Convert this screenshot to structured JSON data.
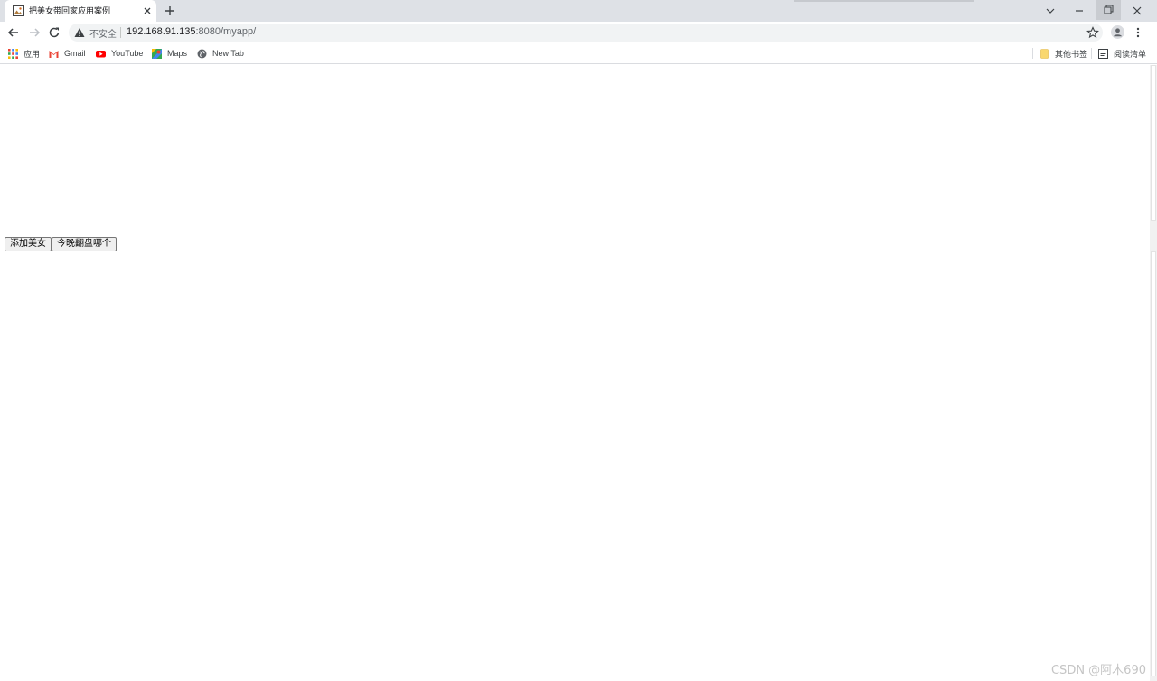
{
  "browser": {
    "tab": {
      "title": "把美女带回家应用案例",
      "favicon": "picture-icon"
    },
    "window_controls": [
      "chevron-down-icon",
      "minimize-icon",
      "restore-icon",
      "close-icon"
    ],
    "address_bar": {
      "security_label": "不安全",
      "url_host": "192.168.91.135",
      "url_path": ":8080/myapp/"
    },
    "bookmarks": {
      "items": [
        {
          "label": "应用",
          "icon": "apps-grid-icon"
        },
        {
          "label": "Gmail",
          "icon": "gmail-icon"
        },
        {
          "label": "YouTube",
          "icon": "youtube-icon"
        },
        {
          "label": "Maps",
          "icon": "maps-icon"
        },
        {
          "label": "New Tab",
          "icon": "globe-icon"
        }
      ],
      "other_bookmarks": "其他书签",
      "reading_list": "阅读清单"
    }
  },
  "page": {
    "buttons": {
      "add": "添加美女",
      "tonight": "今晚翻盘哪个"
    }
  },
  "watermark": "CSDN @阿木690",
  "colors": {
    "tabstrip": "#dee1e6",
    "omnibox": "#f1f3f4",
    "youtube_red": "#ff0000",
    "bookmark_folder": "#f9d76f"
  }
}
